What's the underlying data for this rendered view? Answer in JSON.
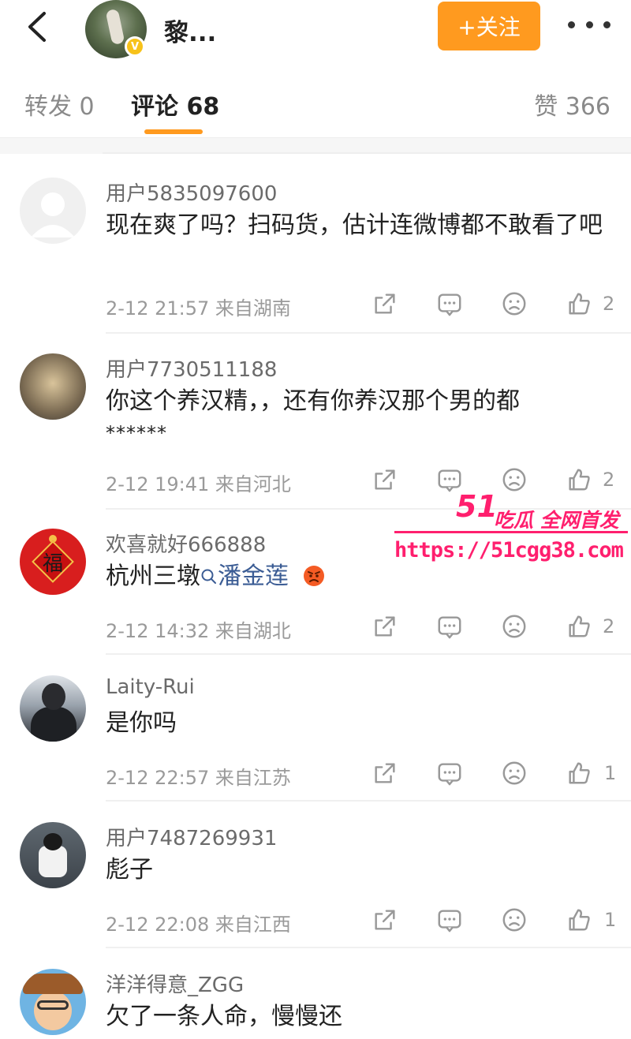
{
  "header": {
    "back_icon": "chevron-left-icon",
    "profile_name": "黎...",
    "follow_label": "+关注",
    "more_icon": "ellipsis-icon",
    "accent_color": "#ff9a1f"
  },
  "tabs": {
    "repost": "转发 0",
    "comment": "评论 68",
    "like": "赞 366"
  },
  "comments": [
    {
      "user": "用户5835097600",
      "text": "现在爽了吗？扫码货，估计连微博都不敢看了吧",
      "time_location": "2-12 21:57 来自湖南",
      "likes": "2"
    },
    {
      "user": "用户7730511188",
      "text_line1": "你这个养汉精，，还有你养汉那个男的都",
      "text_line2": "******",
      "time_location": "2-12 19:41 来自河北",
      "likes": "2"
    },
    {
      "user": "欢喜就好666888",
      "text_prefix": "杭州三墩",
      "search_link": "潘金莲",
      "emoji": "angry-emoji",
      "time_location": "2-12 14:32 来自湖北",
      "likes": "2"
    },
    {
      "user": "Laity-Rui",
      "text": "是你吗",
      "time_location": "2-12 22:57 来自江苏",
      "likes": "1"
    },
    {
      "user": "用户7487269931",
      "text": "彪子",
      "time_location": "2-12 22:08 来自江西",
      "likes": "1"
    },
    {
      "user": "洋洋得意_ZGG",
      "text": "欠了一条人命，慢慢还"
    }
  ],
  "avatar_fu_char": "福",
  "watermark": {
    "brand_number": "51",
    "brand_title": "吃瓜 全网首发",
    "url": "https://51cgg38.com",
    "color": "#ff1f6e"
  }
}
